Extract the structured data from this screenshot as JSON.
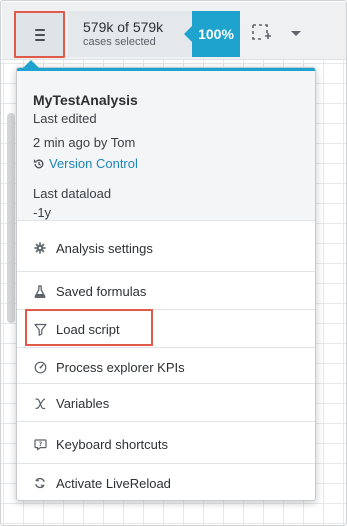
{
  "toolbar": {
    "cases_count": "579k of 579k",
    "cases_label": "cases selected",
    "percent": "100%"
  },
  "icons": {
    "menu": "hamburger-icon",
    "selection": "selection-add-icon",
    "caret": "chevron-down-icon",
    "version": "history-icon",
    "settings": "gear-icon",
    "formulas": "flask-icon",
    "script": "filter-icon",
    "kpis": "gauge-icon",
    "variables": "italic-x-icon",
    "shortcuts": "keyboard-shortcut-icon",
    "reload": "refresh-icon"
  },
  "colors": {
    "accent": "#1ea3cf",
    "highlight": "#e05a47",
    "link": "#1f86b8"
  },
  "analysis": {
    "name": "MyTestAnalysis",
    "last_edited_label": "Last edited",
    "last_edited_value": "2 min ago by Tom",
    "version_control": "Version Control",
    "last_dataload_label": "Last dataload",
    "last_dataload_value": "-1y"
  },
  "menu": {
    "items": [
      {
        "label": "Analysis settings"
      },
      {
        "label": "Saved formulas"
      },
      {
        "label": "Load script"
      },
      {
        "label": "Process explorer KPIs"
      },
      {
        "label": "Variables"
      },
      {
        "label": "Keyboard shortcuts"
      },
      {
        "label": "Activate LiveReload"
      }
    ]
  }
}
